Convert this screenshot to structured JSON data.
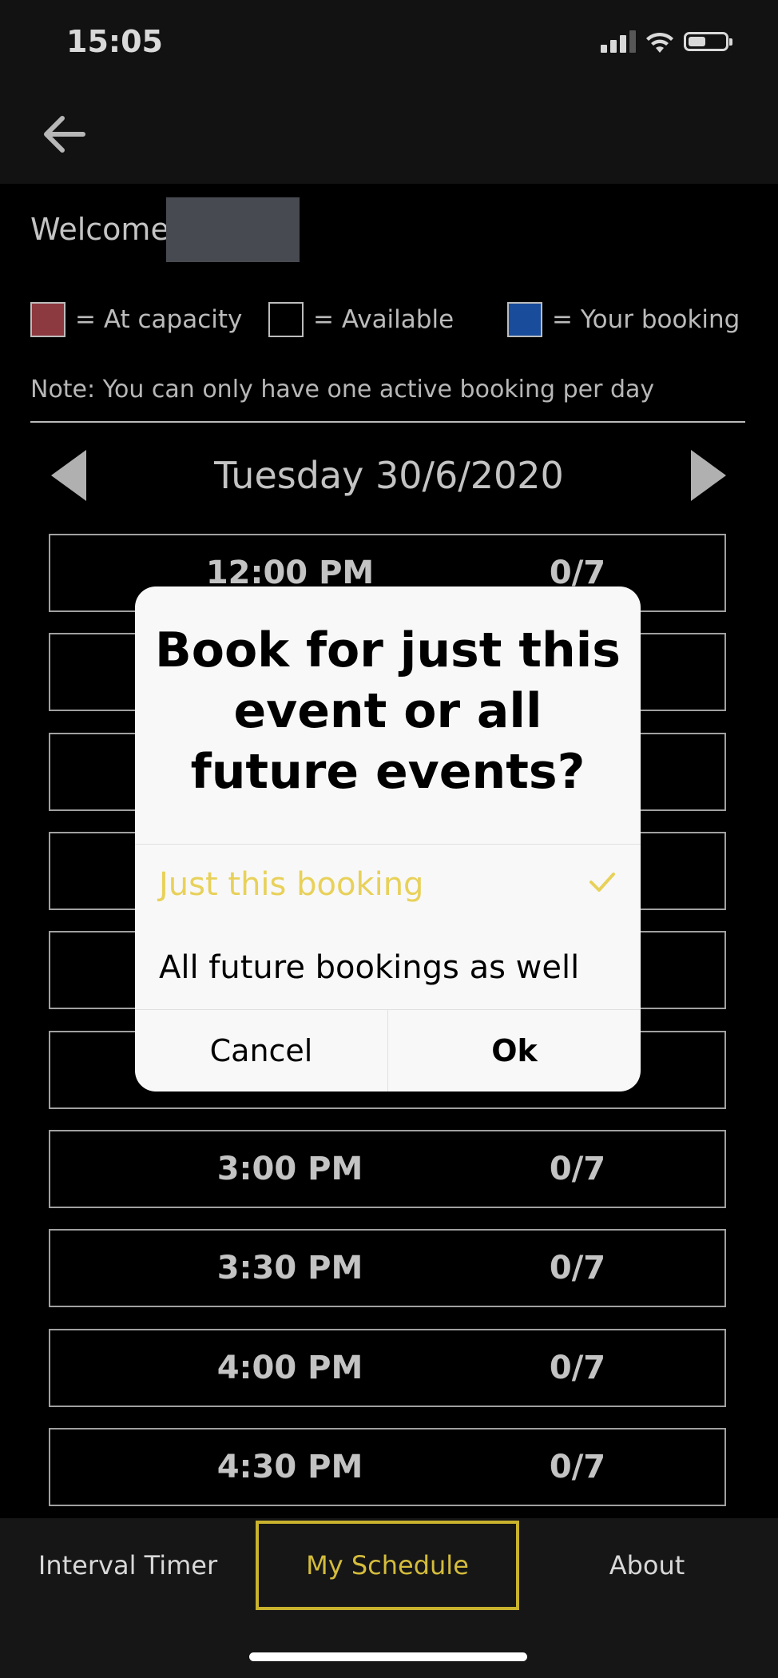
{
  "status_bar": {
    "time": "15:05",
    "icons": [
      "cellular-signal-icon",
      "wifi-icon",
      "battery-icon"
    ]
  },
  "app_bar": {
    "back_icon": "arrow-left-icon"
  },
  "welcome": {
    "label": "Welcome",
    "username_redacted": true
  },
  "legend": [
    {
      "color": "#a6434c",
      "label": "= At capacity"
    },
    {
      "color": "#000000",
      "label": "= Available"
    },
    {
      "color": "#1e5bb8",
      "label": "= Your booking"
    }
  ],
  "note": "Note: You can only have one active booking per day",
  "date_nav": {
    "prev_icon": "triangle-left-icon",
    "date": "Tuesday 30/6/2020",
    "next_icon": "triangle-right-icon"
  },
  "slots": [
    {
      "time": "12:00 PM",
      "count": "0/7"
    },
    {
      "time": "",
      "count": ""
    },
    {
      "time": "",
      "count": ""
    },
    {
      "time": "",
      "count": ""
    },
    {
      "time": "",
      "count": ""
    },
    {
      "time": "",
      "count": ""
    },
    {
      "time": "3:00 PM",
      "count": "0/7"
    },
    {
      "time": "3:30 PM",
      "count": "0/7"
    },
    {
      "time": "4:00 PM",
      "count": "0/7"
    },
    {
      "time": "4:30 PM",
      "count": "0/7"
    }
  ],
  "dialog": {
    "title": "Book for just this event or all future events?",
    "options": [
      {
        "label": "Just this booking",
        "selected": true
      },
      {
        "label": "All future bookings as well",
        "selected": false
      }
    ],
    "cancel_label": "Cancel",
    "ok_label": "Ok",
    "accent_color": "#e8d15a"
  },
  "tab_bar": {
    "tabs": [
      {
        "label": "Interval Timer",
        "active": false
      },
      {
        "label": "My Schedule",
        "active": true
      },
      {
        "label": "About",
        "active": false
      }
    ],
    "active_color": "#c9b22e"
  }
}
